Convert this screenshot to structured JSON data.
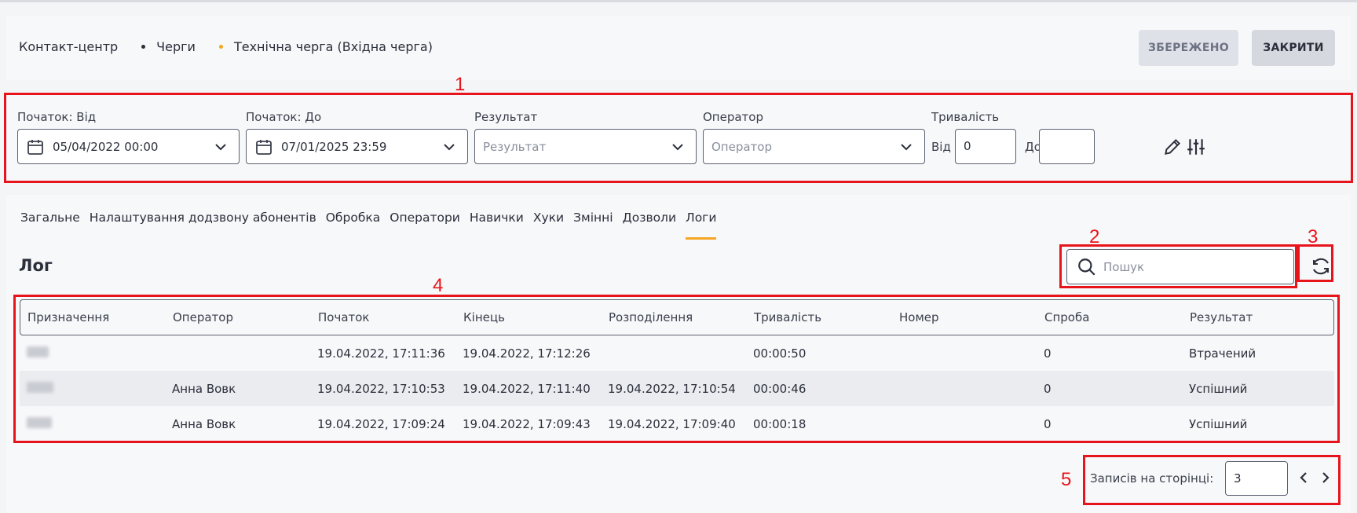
{
  "breadcrumb": [
    "Контакт-центр",
    "Черги",
    "Технічна черга (Вхідна черга)"
  ],
  "buttons": {
    "saved": "ЗБЕРЕЖЕНО",
    "close": "ЗАКРИТИ"
  },
  "filters": {
    "start_from": {
      "label": "Початок: Від",
      "value": "05/04/2022 00:00"
    },
    "start_to": {
      "label": "Початок: До",
      "value": "07/01/2025 23:59"
    },
    "result": {
      "label": "Результат",
      "placeholder": "Результат"
    },
    "operator": {
      "label": "Оператор",
      "placeholder": "Оператор"
    },
    "duration": {
      "label": "Тривалість",
      "from_label": "Від",
      "from_value": "0",
      "to_label": "До",
      "to_value": ""
    }
  },
  "tabs": [
    "Загальне",
    "Налаштування додзвону абонентів",
    "Обробка",
    "Оператори",
    "Навички",
    "Хуки",
    "Змінні",
    "Дозволи",
    "Логи"
  ],
  "active_tab": "Логи",
  "section_title": "Лог",
  "search": {
    "placeholder": "Пошук"
  },
  "table": {
    "columns": [
      "Призначення",
      "Оператор",
      "Початок",
      "Кінець",
      "Розподілення",
      "Тривалість",
      "Номер",
      "Спроба",
      "Результат"
    ],
    "rows": [
      [
        "",
        "",
        "19.04.2022, 17:11:36",
        "19.04.2022, 17:12:26",
        "",
        "00:00:50",
        "",
        "0",
        "Втрачений"
      ],
      [
        "",
        "Анна Вовк",
        "19.04.2022, 17:10:53",
        "19.04.2022, 17:11:40",
        "19.04.2022, 17:10:54",
        "00:00:46",
        "",
        "0",
        "Успішний"
      ],
      [
        "",
        "Анна Вовк",
        "19.04.2022, 17:09:24",
        "19.04.2022, 17:09:43",
        "19.04.2022, 17:09:40",
        "00:00:18",
        "",
        "0",
        "Успішний"
      ]
    ]
  },
  "pagination": {
    "label": "Записів на сторінці:",
    "per_page": "3"
  },
  "annotations": [
    "1",
    "2",
    "3",
    "4",
    "5"
  ],
  "colors": {
    "accent": "#f5a623",
    "annotation": "#e8141b"
  }
}
